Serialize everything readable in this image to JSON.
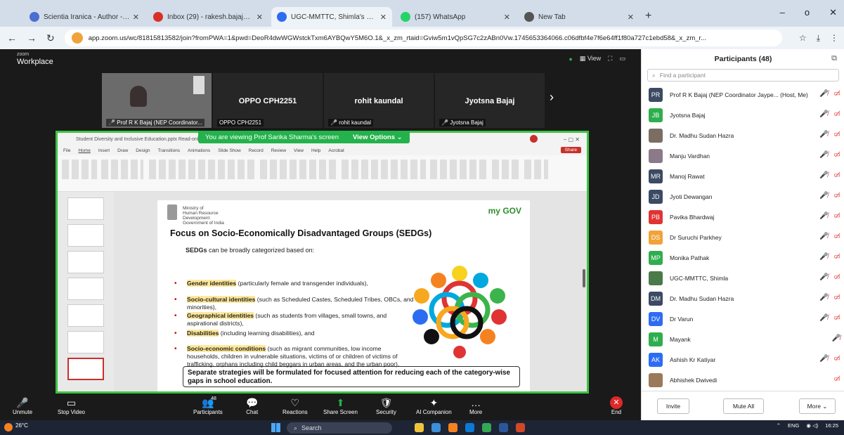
{
  "browser": {
    "tabs": [
      {
        "label": "Scientia Iranica - Author - Subm",
        "icon_color": "#4a6fd1",
        "active": false
      },
      {
        "label": "Inbox (29) - rakesh.bajaj@juitso",
        "icon_color": "#d93025",
        "active": false
      },
      {
        "label": "UGC-MMTTC, Shimla's Zoo",
        "icon_color": "#2d6cf2",
        "active": true
      },
      {
        "label": "(157) WhatsApp",
        "icon_color": "#25d366",
        "active": false
      },
      {
        "label": "New Tab",
        "icon_color": "#555555",
        "active": false
      }
    ],
    "new_tab": "+",
    "url": "app.zoom.us/wc/81815813582/join?fromPWA=1&pwd=DeoR4dwWGWstckTxm6AYBQwY5M6O.1&_x_zm_rtaid=Gviw5m1vQpSG7c2zABn0Vw.1745653364066.c06dfbf4e7f6e64ff1f80a727c1ebd58&_x_zm_r..."
  },
  "zoom": {
    "brand_top": "zoom",
    "brand_bottom": "Workplace",
    "view_label": "View",
    "thumbs": [
      {
        "name_big": "",
        "name_small": "Prof R K Bajaj (NEP Coordinator...",
        "camera": true
      },
      {
        "name_big": "OPPO CPH2251",
        "name_small": "OPPO CPH2251",
        "camera": false
      },
      {
        "name_big": "rohit kaundal",
        "name_small": "rohit kaundal",
        "camera": false
      },
      {
        "name_big": "Jyotsna Bajaj",
        "name_small": "Jyotsna Bajaj",
        "camera": false
      }
    ],
    "viewing_banner": "You are viewing  Prof Sarika Sharma's screen",
    "view_options": "View Options",
    "toolbar": [
      {
        "label": "Unmute",
        "glyph": "🎤",
        "id": "unmute"
      },
      {
        "label": "Stop Video",
        "glyph": "▭",
        "id": "stop-video"
      },
      {
        "label": "Participants",
        "glyph": "👥",
        "badge": "48",
        "id": "participants"
      },
      {
        "label": "Chat",
        "glyph": "💬",
        "id": "chat"
      },
      {
        "label": "Reactions",
        "glyph": "♡",
        "id": "reactions"
      },
      {
        "label": "Share Screen",
        "glyph": "⬆",
        "id": "share-screen"
      },
      {
        "label": "Security",
        "glyph": "🛡",
        "id": "security"
      },
      {
        "label": "AI Companion",
        "glyph": "✦",
        "id": "ai-companion"
      },
      {
        "label": "More",
        "glyph": "…",
        "id": "more"
      },
      {
        "label": "End",
        "glyph": "✕",
        "id": "end"
      }
    ]
  },
  "ppt": {
    "title_bar": "Student Diversity and Inclusive Education.pptx  Read-only  Compatibility Mode",
    "menu": [
      "File",
      "Home",
      "Insert",
      "Draw",
      "Design",
      "Transitions",
      "Animations",
      "Slide Show",
      "Record",
      "Review",
      "View",
      "Help",
      "Acrobat"
    ],
    "share_btn": "Share",
    "slide": {
      "ministry": "Ministry of\nHuman Resource\nDevelopment\nGovernment of India",
      "gov_logo": "my GOV",
      "title": "Focus on Socio-Economically Disadvantaged Groups (SEDGs)",
      "intro_bold": "SEDGs",
      "intro_rest": " can be broadly categorized based on:",
      "bullets": [
        {
          "hl": "Gender identities",
          "rest": " (particularly female and transgender individuals),"
        },
        {
          "hl": "Socio-cultural identities",
          "rest": " (such as Scheduled Castes, Scheduled Tribes, OBCs, and minorities),"
        },
        {
          "hl": "Geographical identities",
          "rest": " (such as students from villages, small towns, and aspirational districts),"
        },
        {
          "hl": "Disabilities",
          "rest": " (including learning disabilities), and"
        },
        {
          "hl": "Socio-economic conditions",
          "rest": " (such as migrant communities, low income households, children in vulnerable situations, victims of or children of victims of trafficking, orphans including child beggars in urban areas, and the urban poor)."
        }
      ],
      "box_text": "Separate strategies will be formulated for focused attention for reducing each of the category-wise gaps in school education."
    }
  },
  "participants": {
    "title": "Participants (48)",
    "search_placeholder": "Find a participant",
    "list": [
      {
        "initials": "PR",
        "color": "#3c4a63",
        "name": "Prof R K Bajaj (NEP Coordinator Jaype...  (Host, Me)",
        "muted": true,
        "video_off": true
      },
      {
        "initials": "JB",
        "color": "#2fae4e",
        "name": "Jyotsna Bajaj",
        "muted": true,
        "video_off": true
      },
      {
        "initials": "",
        "color": "#7a6e63",
        "name": "Dr. Madhu Sudan Hazra",
        "muted": true,
        "video_off": true
      },
      {
        "initials": "",
        "color": "#8a7a8a",
        "name": "Manju Vardhan",
        "muted": true,
        "video_off": true
      },
      {
        "initials": "MR",
        "color": "#3c4a63",
        "name": "Manoj Rawat",
        "muted": true,
        "video_off": true
      },
      {
        "initials": "JD",
        "color": "#3c4a63",
        "name": "Jyoti Dewangan",
        "muted": true,
        "video_off": true
      },
      {
        "initials": "PB",
        "color": "#e03434",
        "name": "Pavika Bhardwaj",
        "muted": true,
        "video_off": true
      },
      {
        "initials": "DS",
        "color": "#f0a33a",
        "name": "Dr Suruchi Parkhey",
        "muted": true,
        "video_off": true
      },
      {
        "initials": "MP",
        "color": "#2fae4e",
        "name": "Monika Pathak",
        "muted": true,
        "video_off": true
      },
      {
        "initials": "",
        "color": "#4a7a4a",
        "name": "UGC-MMTTC, Shimla",
        "muted": true,
        "video_off": true
      },
      {
        "initials": "DM",
        "color": "#3c4a63",
        "name": "Dr. Madhu Sudan Hazra",
        "muted": true,
        "video_off": true
      },
      {
        "initials": "DV",
        "color": "#2d6cf2",
        "name": "Dr Varun",
        "muted": true,
        "video_off": true
      },
      {
        "initials": "M",
        "color": "#2fae4e",
        "name": "Mayank",
        "muted": true,
        "video_off": false
      },
      {
        "initials": "AK",
        "color": "#2d6cf2",
        "name": "Ashish Kr Katiyar",
        "muted": true,
        "video_off": true
      },
      {
        "initials": "",
        "color": "#9a7a5a",
        "name": "Abhishek Dwivedi",
        "muted": false,
        "video_off": true
      }
    ],
    "invite": "Invite",
    "mute_all": "Mute All",
    "more": "More"
  },
  "taskbar": {
    "weather": "26°C",
    "search": "Search",
    "lang": "ENG",
    "time": "16:25"
  },
  "colors": {
    "share_border": "#3cc343",
    "zoom_bg": "#1a1a1a",
    "end_red": "#e02828"
  }
}
